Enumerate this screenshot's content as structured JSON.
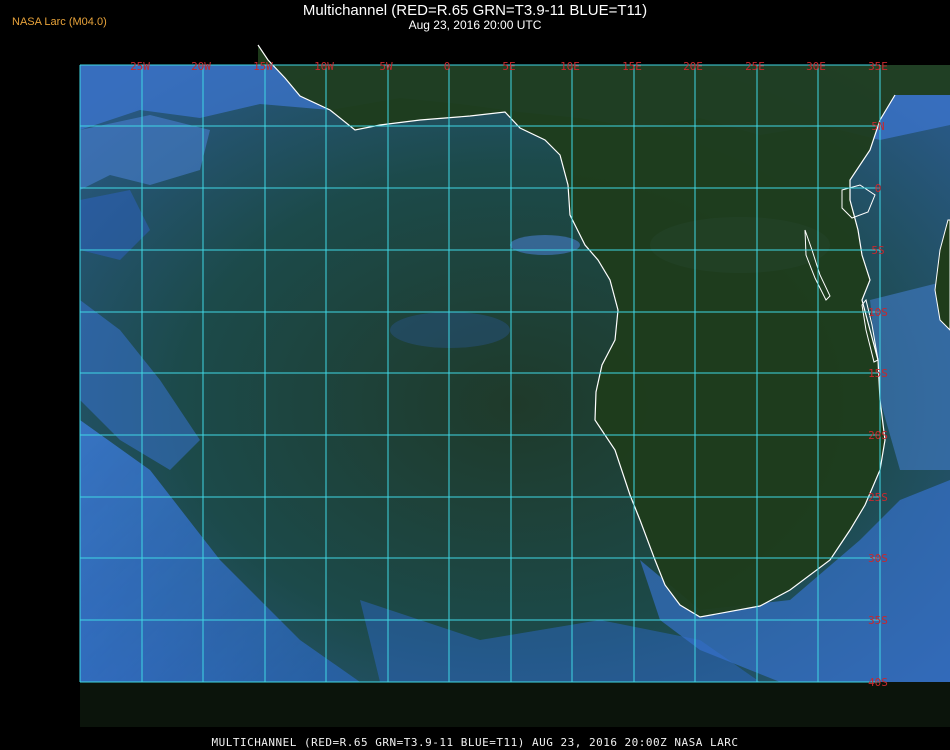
{
  "header": {
    "brand": "NASA Larc (M04.0)",
    "title": "Multichannel (RED=R.65 GRN=T3.9-11 BLUE=T11)",
    "subtitle": "Aug 23, 2016 20:00 UTC"
  },
  "footer": {
    "caption": "MULTICHANNEL (RED=R.65 GRN=T3.9-11 BLUE=T11) AUG 23, 2016 20:00Z NASA LARC"
  },
  "map": {
    "lon_labels": [
      "25W",
      "20W",
      "15W",
      "10W",
      "5W",
      "0",
      "5E",
      "10E",
      "15E",
      "20E",
      "25E",
      "30E",
      "35E"
    ],
    "lat_labels": [
      "5N",
      "0",
      "5S",
      "10S",
      "15S",
      "20S",
      "25S",
      "30S",
      "35S",
      "40S"
    ],
    "colors": {
      "grid": "#3fd7e4",
      "coast": "#ffffff",
      "label": "#c8282d",
      "ocean": "#2a5d8c",
      "land": "#21401d",
      "cloud": "#5a9bea"
    }
  }
}
